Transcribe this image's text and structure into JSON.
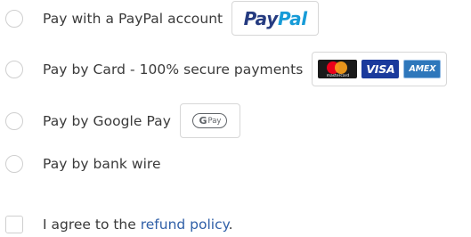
{
  "payment_options": [
    {
      "label": "Pay with a PayPal account",
      "badge": {
        "type": "paypal",
        "text_part1": "Pay",
        "text_part2": "Pal"
      }
    },
    {
      "label": "Pay by Card - 100% secure payments",
      "badge": {
        "type": "cards",
        "mastercard_text": "mastercard",
        "visa_text": "VISA",
        "amex_text": "AMEX"
      }
    },
    {
      "label": "Pay by Google Pay",
      "badge": {
        "type": "gpay",
        "g_text": "G",
        "pay_text": "Pay"
      }
    },
    {
      "label": "Pay by bank wire"
    }
  ],
  "terms": {
    "prefix": "I agree to the ",
    "link_text": "refund policy",
    "suffix": "."
  },
  "colors": {
    "paypal_dark": "#253b80",
    "paypal_light": "#179bd7",
    "link": "#2f5fa7",
    "text": "#3a3a3a",
    "border": "#cfcfcf"
  }
}
